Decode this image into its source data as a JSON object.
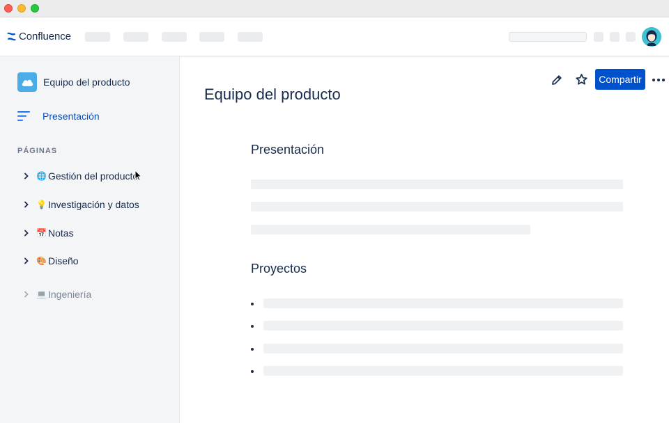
{
  "app": {
    "name": "Confluence",
    "brand_color": "#0052cc"
  },
  "sidebar": {
    "space_name": "Equipo del producto",
    "overview_label": "Presentación",
    "section_title": "PÁGINAS",
    "items": [
      {
        "label": "Gestión del producto",
        "emoji": "🌐",
        "state": "normal"
      },
      {
        "label": "Investigación y datos",
        "emoji": "💡",
        "state": "normal"
      },
      {
        "label": "Notas",
        "emoji": "📅",
        "state": "normal"
      },
      {
        "label": "Diseño",
        "emoji": "🎨",
        "state": "normal"
      },
      {
        "label": "Ingeniería",
        "emoji": "💻",
        "state": "muted"
      }
    ]
  },
  "toolbar": {
    "share_label": "Compartir",
    "icons": [
      "pencil-icon",
      "star-icon",
      "more-icon"
    ]
  },
  "page": {
    "title": "Equipo del producto",
    "sections": [
      {
        "heading": "Presentación"
      },
      {
        "heading": "Proyectos"
      }
    ]
  }
}
